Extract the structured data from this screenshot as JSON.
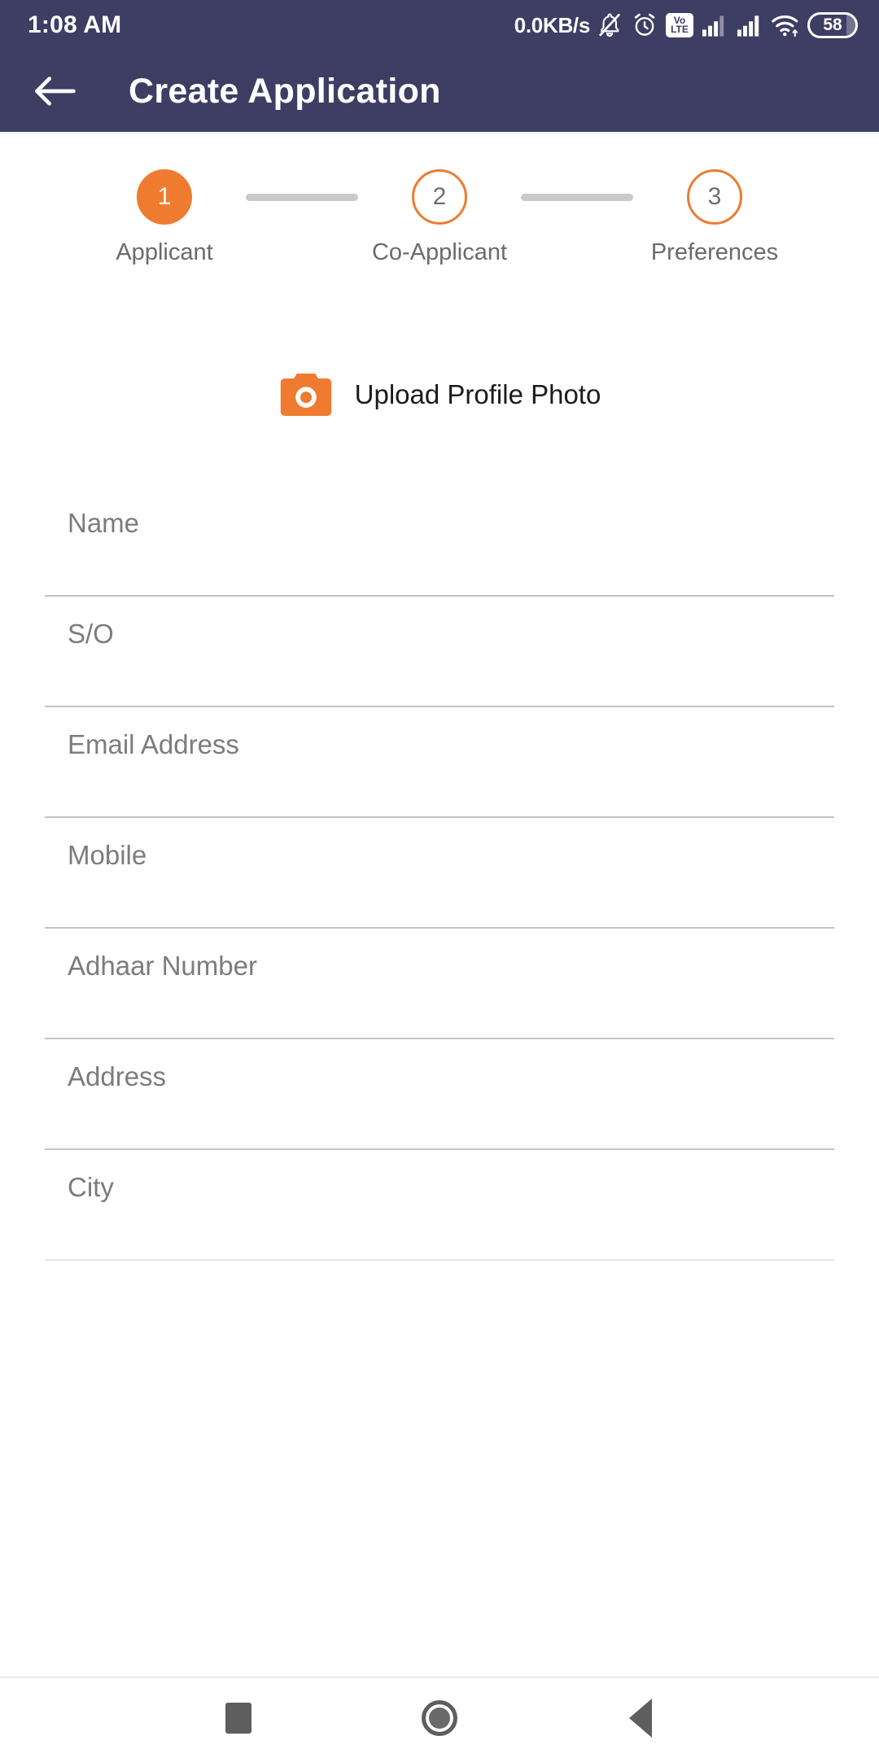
{
  "status_bar": {
    "time": "1:08 AM",
    "network_speed": "0.0KB/s",
    "volte_top": "Vo",
    "volte_bottom": "LTE",
    "battery_percent": "58",
    "icons": [
      "silent-bell-icon",
      "alarm-clock-icon",
      "volte-icon",
      "signal-1-icon",
      "signal-2-icon",
      "wifi-icon",
      "battery-icon"
    ]
  },
  "app_bar": {
    "back_icon": "back-arrow-icon",
    "title": "Create Application"
  },
  "stepper": {
    "steps": [
      {
        "number": "1",
        "label": "Applicant",
        "state": "active"
      },
      {
        "number": "2",
        "label": "Co-Applicant",
        "state": "inactive"
      },
      {
        "number": "3",
        "label": "Preferences",
        "state": "inactive"
      }
    ]
  },
  "upload": {
    "icon": "camera-icon",
    "label": "Upload Profile Photo"
  },
  "form": {
    "fields": [
      {
        "name": "name",
        "placeholder": "Name",
        "value": ""
      },
      {
        "name": "so",
        "placeholder": "S/O",
        "value": ""
      },
      {
        "name": "email",
        "placeholder": "Email Address",
        "value": ""
      },
      {
        "name": "mobile",
        "placeholder": "Mobile",
        "value": ""
      },
      {
        "name": "adhaar",
        "placeholder": "Adhaar Number",
        "value": ""
      },
      {
        "name": "address",
        "placeholder": "Address",
        "value": ""
      },
      {
        "name": "city",
        "placeholder": "City",
        "value": ""
      }
    ]
  },
  "nav_bar": {
    "recents": "recents-square-icon",
    "home": "home-circle-icon",
    "back": "back-triangle-icon"
  },
  "colors": {
    "header": "#3E3D63",
    "accent": "#EE7B30",
    "muted_line": "#c9c9c9",
    "placeholder_text": "#7c7c7c"
  }
}
